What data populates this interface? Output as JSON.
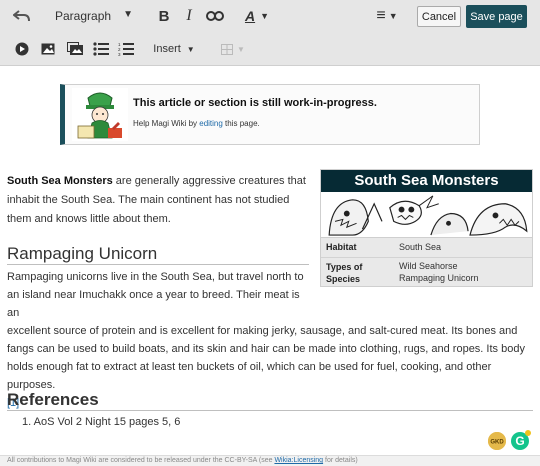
{
  "toolbar": {
    "format_label": "Paragraph",
    "bold": "B",
    "italic": "I",
    "text_style": "A",
    "cancel_label": "Cancel",
    "save_label": "Save page",
    "insert_label": "Insert",
    "colors": {
      "save": "#1b4f5b",
      "bar": "#e6e6e6"
    }
  },
  "notice": {
    "title": "This article or section is still work-in-progress.",
    "text_before": "Help Magi Wiki by ",
    "link": "editing",
    "text_after": " this page."
  },
  "intro": {
    "bold": "South Sea Monsters",
    "text": " are generally aggressive creatures that inhabit the South Sea. The main continent has not studied them and knows little about them."
  },
  "infobox": {
    "title": "South Sea Monsters",
    "rows": [
      {
        "key": "Habitat",
        "value": "South Sea"
      },
      {
        "key": "Types of Species",
        "value_1": "Wild Seahorse",
        "value_2": "Rampaging Unicorn"
      }
    ],
    "title_color": "#062a34"
  },
  "section_rampaging": {
    "heading": "Rampaging Unicorn",
    "para_narrow_1": "Rampaging unicorns live in the South Sea, but travel north to",
    "para_narrow_2": "an island near Imuchakk once a year to breed. Their meat is an",
    "para_rest": "excellent source of protein and is excellent for making jerky, sausage, and salt-cured meat. Its bones and fangs can be used to build boats, and its skin and hair can be made into clothing, rugs, and ropes. Its body holds enough fat to extract at least ten buckets of oil, which can be used for fuel, cooking, and other purposes.",
    "cite": "[1]"
  },
  "references": {
    "heading": "References",
    "items": [
      "1. AoS Vol 2 Night 15 pages 5, 6"
    ]
  },
  "footer": {
    "text_before": "All contributions to Magi Wiki are considered to be released under the CC-BY-SA (see ",
    "link": "Wikia:Licensing",
    "text_after": " for details)"
  },
  "extensions": {
    "ghost_label": "GKD",
    "g_label": "G"
  }
}
